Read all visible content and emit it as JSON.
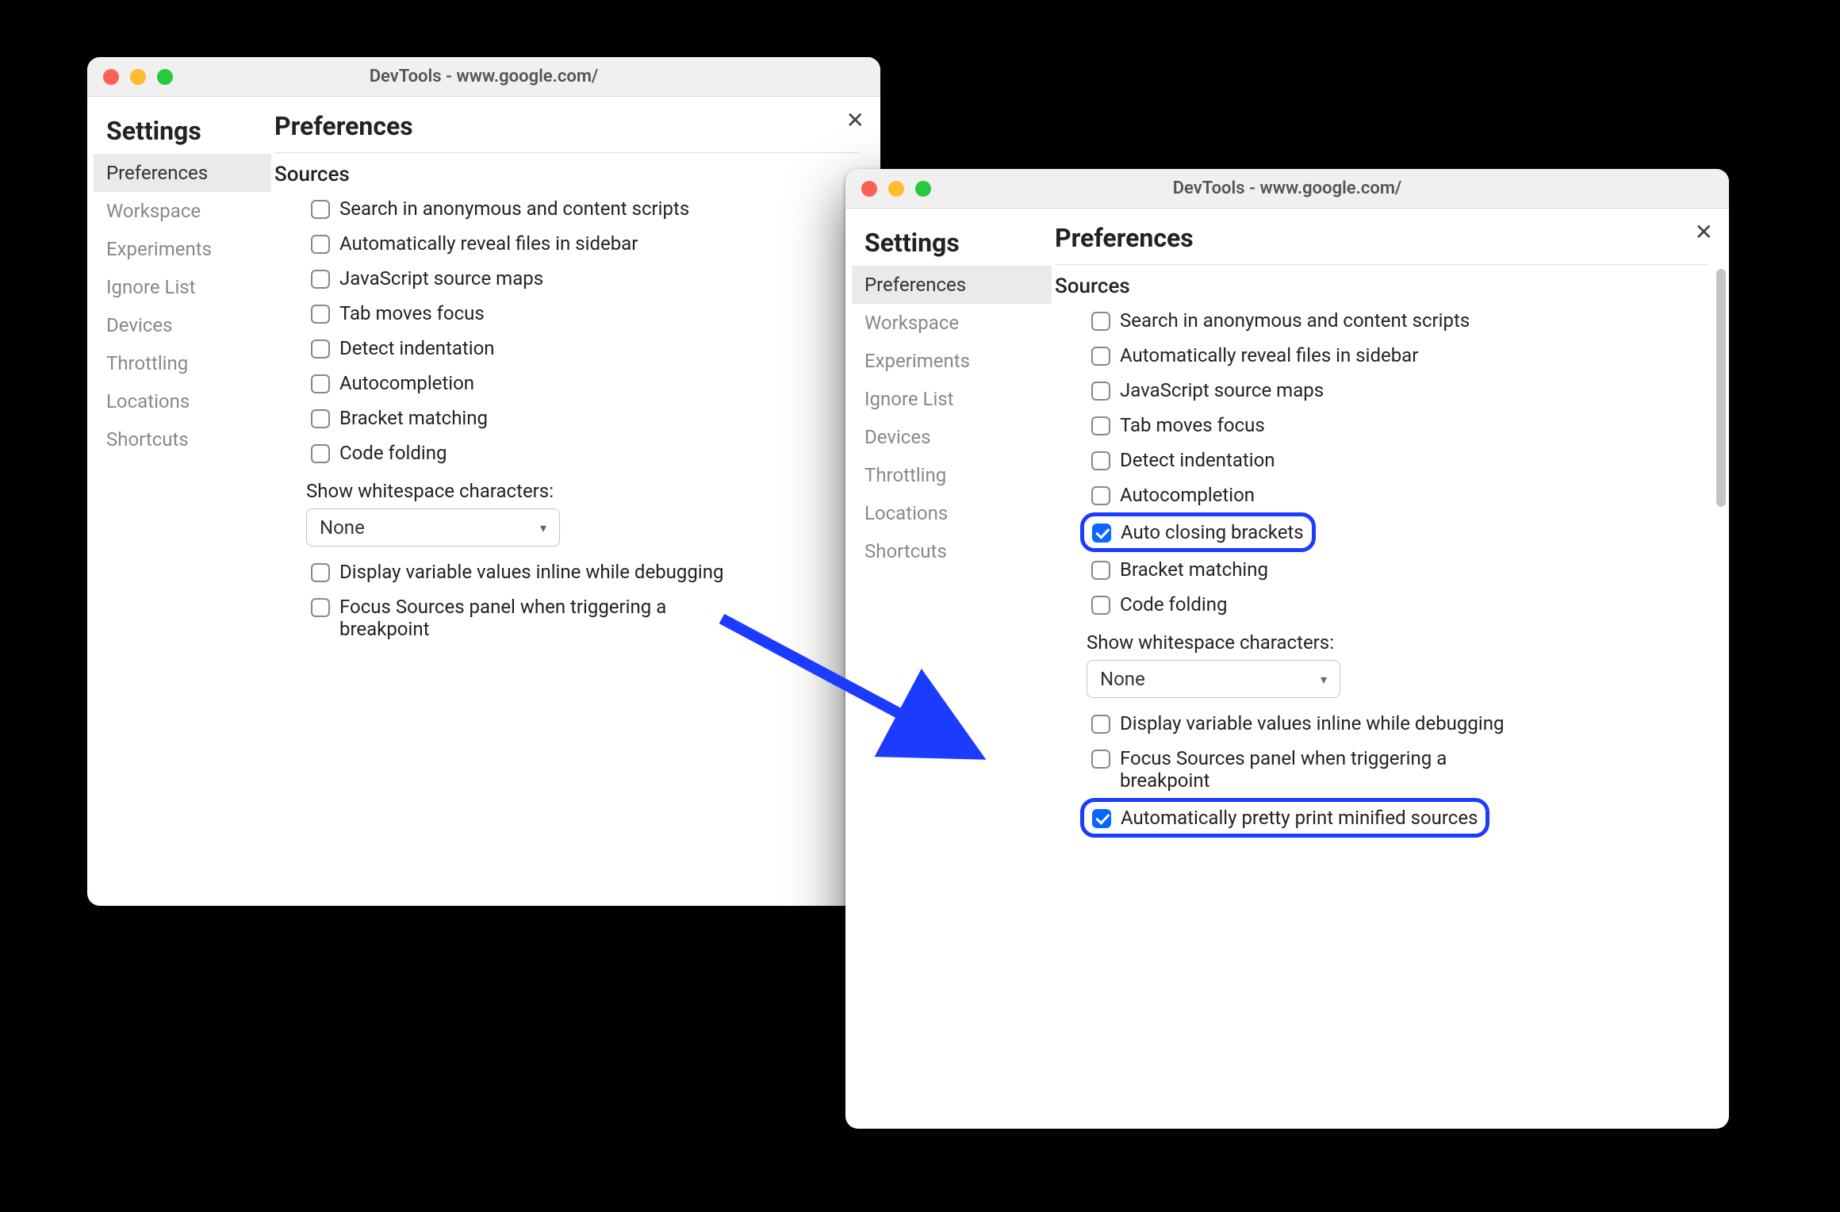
{
  "colors": {
    "highlight_border": "#1b3bff",
    "checkbox_checked": "#0a66ff"
  },
  "arrow": {
    "present": true
  },
  "windows": {
    "left": {
      "title": "DevTools - www.google.com/",
      "settings_heading": "Settings",
      "main_heading": "Preferences",
      "sidebar": {
        "items": [
          {
            "label": "Preferences",
            "active": true
          },
          {
            "label": "Workspace",
            "active": false
          },
          {
            "label": "Experiments",
            "active": false
          },
          {
            "label": "Ignore List",
            "active": false
          },
          {
            "label": "Devices",
            "active": false
          },
          {
            "label": "Throttling",
            "active": false
          },
          {
            "label": "Locations",
            "active": false
          },
          {
            "label": "Shortcuts",
            "active": false
          }
        ]
      },
      "section": {
        "title": "Sources",
        "options": [
          {
            "label": "Search in anonymous and content scripts",
            "checked": false
          },
          {
            "label": "Automatically reveal files in sidebar",
            "checked": false
          },
          {
            "label": "JavaScript source maps",
            "checked": false
          },
          {
            "label": "Tab moves focus",
            "checked": false
          },
          {
            "label": "Detect indentation",
            "checked": false
          },
          {
            "label": "Autocompletion",
            "checked": false
          },
          {
            "label": "Bracket matching",
            "checked": false
          },
          {
            "label": "Code folding",
            "checked": false
          }
        ],
        "whitespace": {
          "label": "Show whitespace characters:",
          "selected": "None"
        },
        "trailing_options": [
          {
            "label": "Display variable values inline while debugging",
            "checked": false
          },
          {
            "label": "Focus Sources panel when triggering a breakpoint",
            "checked": false
          }
        ]
      }
    },
    "right": {
      "title": "DevTools - www.google.com/",
      "settings_heading": "Settings",
      "main_heading": "Preferences",
      "sidebar": {
        "items": [
          {
            "label": "Preferences",
            "active": true
          },
          {
            "label": "Workspace",
            "active": false
          },
          {
            "label": "Experiments",
            "active": false
          },
          {
            "label": "Ignore List",
            "active": false
          },
          {
            "label": "Devices",
            "active": false
          },
          {
            "label": "Throttling",
            "active": false
          },
          {
            "label": "Locations",
            "active": false
          },
          {
            "label": "Shortcuts",
            "active": false
          }
        ]
      },
      "section": {
        "title": "Sources",
        "options": [
          {
            "label": "Search in anonymous and content scripts",
            "checked": false,
            "highlight": false
          },
          {
            "label": "Automatically reveal files in sidebar",
            "checked": false,
            "highlight": false
          },
          {
            "label": "JavaScript source maps",
            "checked": false,
            "highlight": false
          },
          {
            "label": "Tab moves focus",
            "checked": false,
            "highlight": false
          },
          {
            "label": "Detect indentation",
            "checked": false,
            "highlight": false
          },
          {
            "label": "Autocompletion",
            "checked": false,
            "highlight": false
          },
          {
            "label": "Auto closing brackets",
            "checked": true,
            "highlight": true
          },
          {
            "label": "Bracket matching",
            "checked": false,
            "highlight": false
          },
          {
            "label": "Code folding",
            "checked": false,
            "highlight": false
          }
        ],
        "whitespace": {
          "label": "Show whitespace characters:",
          "selected": "None"
        },
        "trailing_options": [
          {
            "label": "Display variable values inline while debugging",
            "checked": false,
            "highlight": false
          },
          {
            "label": "Focus Sources panel when triggering a breakpoint",
            "checked": false,
            "highlight": false
          },
          {
            "label": "Automatically pretty print minified sources",
            "checked": true,
            "highlight": true
          }
        ]
      }
    }
  }
}
